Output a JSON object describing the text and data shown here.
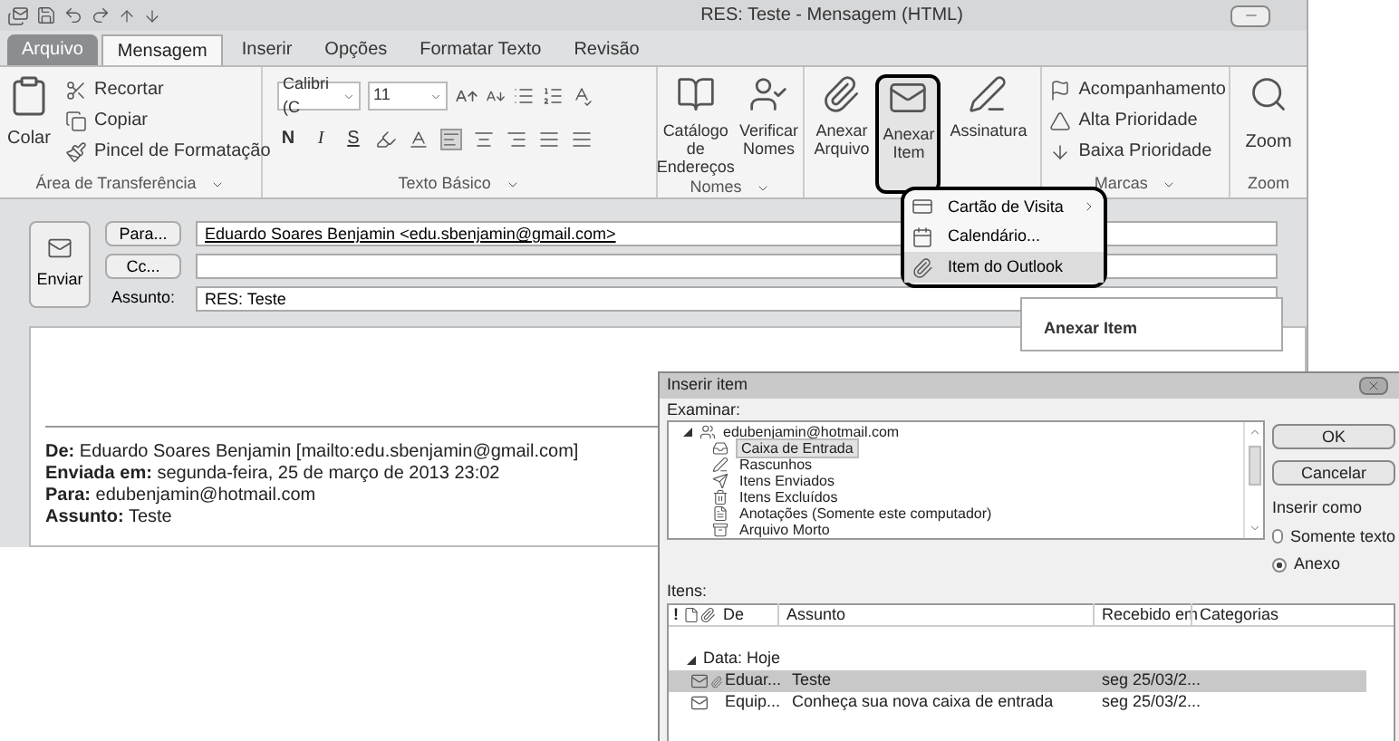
{
  "window": {
    "title": "RES: Teste - Mensagem (HTML)"
  },
  "ribbon_tabs": [
    {
      "label": "Arquivo",
      "kind": "file",
      "selected": false
    },
    {
      "label": "Mensagem",
      "kind": "tab",
      "selected": true
    },
    {
      "label": "Inserir",
      "kind": "tab",
      "selected": false
    },
    {
      "label": "Opções",
      "kind": "tab",
      "selected": false
    },
    {
      "label": "Formatar Texto",
      "kind": "tab",
      "selected": false
    },
    {
      "label": "Revisão",
      "kind": "tab",
      "selected": false
    }
  ],
  "clipboard": {
    "label": "Área de Transferência",
    "paste": "Colar",
    "cut": "Recortar",
    "copy": "Copiar",
    "format_painter": "Pincel de Formatação"
  },
  "basic_text": {
    "label": "Texto Básico",
    "font": "Calibri (C",
    "size": "11",
    "bold": "N",
    "italic": "I",
    "underline": "S"
  },
  "names": {
    "label": "Nomes",
    "address_book": "Catálogo de Endereços",
    "check_names": "Verificar Nomes"
  },
  "include": {
    "buttons": [
      {
        "label": "Anexar Arquivo",
        "kind": "clip",
        "highlighted": false
      },
      {
        "label": "Anexar Item",
        "kind": "item",
        "highlighted": true
      },
      {
        "label": "Assinatura",
        "kind": "sign",
        "highlighted": false
      }
    ]
  },
  "tags": {
    "label": "Marcas",
    "follow_up": "Acompanhamento",
    "high": "Alta Prioridade",
    "low": "Baixa Prioridade"
  },
  "zoom": {
    "label": "Zoom",
    "button": "Zoom"
  },
  "attach_menu": {
    "items": [
      {
        "label": "Cartão de Visita",
        "kind": "card",
        "submenu": true,
        "selected": false
      },
      {
        "label": "Calendário...",
        "kind": "calendar",
        "submenu": false,
        "selected": false
      },
      {
        "label": "Item do Outlook",
        "kind": "item",
        "submenu": false,
        "selected": true
      }
    ]
  },
  "tooltip": {
    "title": "Anexar Item"
  },
  "compose": {
    "send": "Enviar",
    "to_button": "Para...",
    "to": "Eduardo Soares Benjamin <edu.sbenjamin@gmail.com>",
    "cc_button": "Cc...",
    "subject_label": "Assunto:",
    "subject": "RES: Teste"
  },
  "body": {
    "lines": [
      "**De:** Eduardo Soares Benjamin [mailto:edu.sbenjamin@gmail.com]",
      "**Enviada em:** segunda-feira, 25 de março de 2013 23:02",
      "**Para:** edubenjamin@hotmail.com",
      "**Assunto:** Teste"
    ]
  },
  "dialog": {
    "title": "Inserir item",
    "look_in_label": "Examinar:",
    "tree": {
      "label": "edubenjamin@hotmail.com",
      "expanded": true,
      "children": [
        {
          "label": "Caixa de Entrada",
          "kind": "inbox",
          "selected": true
        },
        {
          "label": "Rascunhos",
          "kind": "drafts",
          "selected": false
        },
        {
          "label": "Itens Enviados",
          "kind": "sent",
          "selected": false
        },
        {
          "label": "Itens Excluídos",
          "kind": "trash",
          "selected": false
        },
        {
          "label": "Anotações (Somente este computador)",
          "kind": "notes",
          "selected": false
        },
        {
          "label": "Arquivo Morto",
          "kind": "archive",
          "selected": false
        }
      ]
    },
    "ok": "OK",
    "cancel": "Cancelar",
    "insert_as_label": "Inserir como",
    "insert_as": [
      {
        "label": "Somente texto",
        "selected": false
      },
      {
        "label": "Anexo",
        "selected": true
      }
    ],
    "items_label": "Itens:",
    "columns": [
      "!",
      "De",
      "Assunto",
      "Recebido em",
      "Categorias"
    ],
    "group": "Data: Hoje",
    "rows": [
      {
        "from": "Eduar...",
        "subject": "Teste",
        "received": "seg 25/03/2...",
        "attachment": true,
        "selected": true
      },
      {
        "from": "Equip...",
        "subject": "Conheça sua nova caixa de entrada",
        "received": "seg 25/03/2...",
        "attachment": false,
        "selected": false
      }
    ]
  }
}
